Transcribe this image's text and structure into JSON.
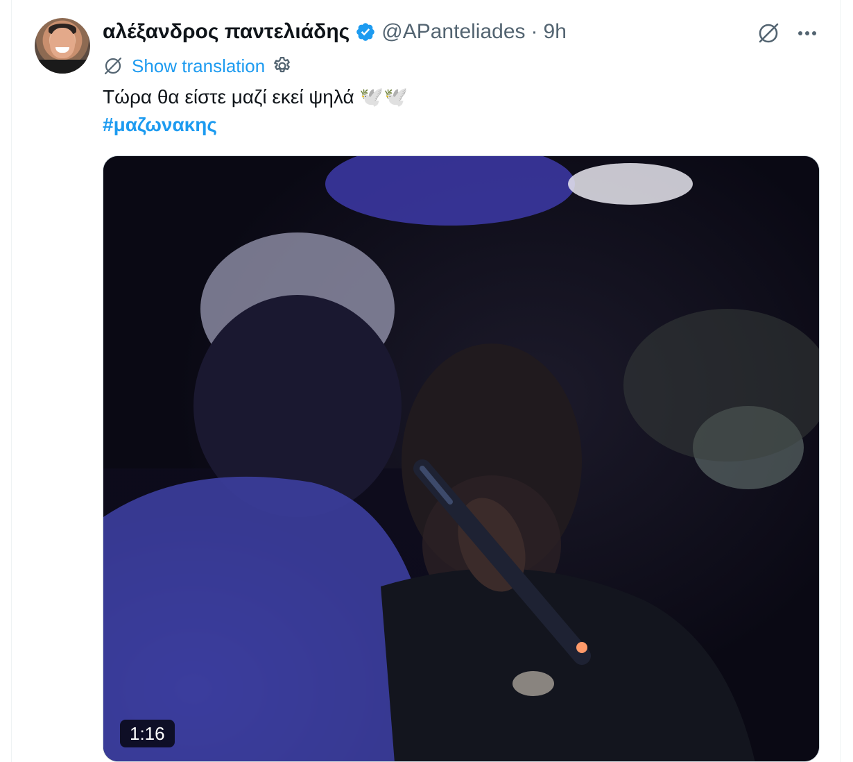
{
  "tweet": {
    "author": {
      "display_name": "αλέξανδρος παντελιάδης",
      "handle": "@APanteliades",
      "verified": true
    },
    "separator": "·",
    "time": "9h",
    "translation_label": "Show translation",
    "text": "Τώρα θα είστε μαζί εκεί ψηλά 🕊️🕊️",
    "hashtag": "#μαζωνακης",
    "media": {
      "type": "video",
      "duration": "1:16"
    }
  },
  "colors": {
    "accent": "#1d9bf0",
    "secondary_text": "#536471",
    "primary_text": "#0f1419"
  },
  "icons": [
    "grok-icon",
    "more-icon",
    "translate-icon",
    "settings-icon",
    "verified-icon"
  ]
}
